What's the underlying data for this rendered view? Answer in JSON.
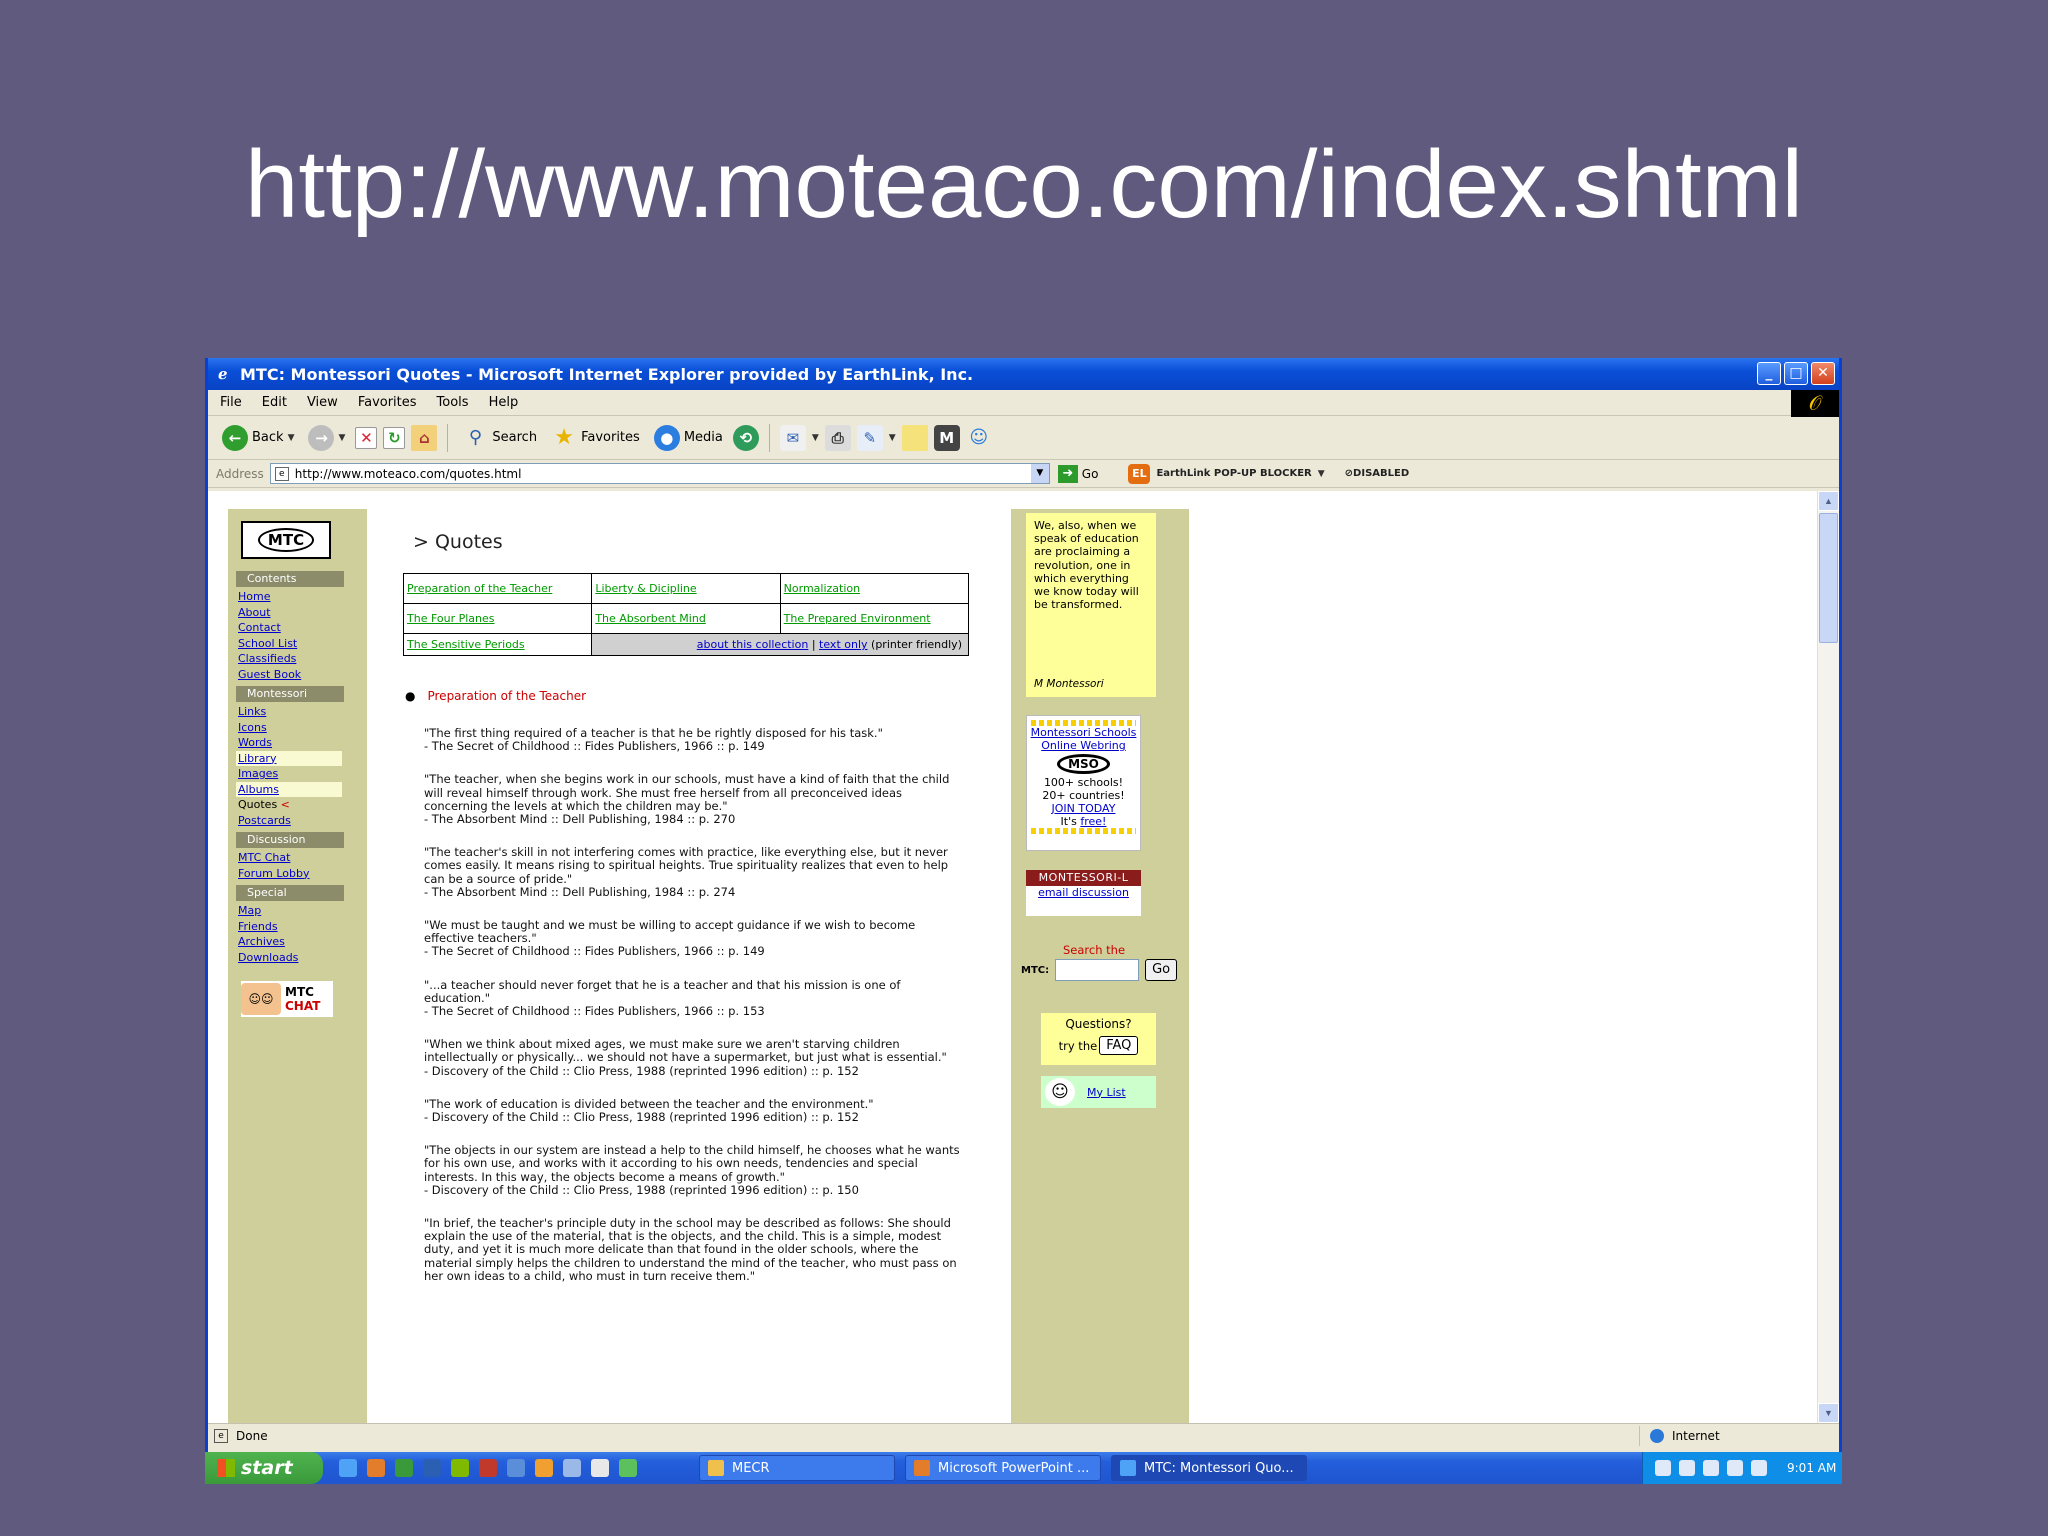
{
  "slide": {
    "title": "http://www.moteaco.com/index.shtml"
  },
  "window": {
    "title": "MTC: Montessori Quotes - Microsoft Internet Explorer provided by EarthLink, Inc.",
    "buttons": {
      "minimize": "_",
      "maximize": "□",
      "close": "✕"
    }
  },
  "menu": [
    "File",
    "Edit",
    "View",
    "Favorites",
    "Tools",
    "Help"
  ],
  "toolbar": {
    "back": "Back",
    "search": "Search",
    "favorites": "Favorites",
    "media": "Media"
  },
  "address": {
    "label": "Address",
    "url": "http://www.moteaco.com/quotes.html",
    "go": "Go",
    "popup_blocker": "EarthLink POP-UP BLOCKER",
    "popup_status": "DISABLED"
  },
  "sidebar": {
    "logo": "MTC",
    "sections": [
      {
        "title": "Contents",
        "links": [
          "Home",
          "About",
          "Contact",
          "School List",
          "Classifieds",
          "Guest Book"
        ]
      },
      {
        "title": "Montessori",
        "links": [
          "Links",
          "Icons",
          "Words",
          "Library",
          "Images",
          "Albums",
          "Quotes",
          "Postcards"
        ]
      },
      {
        "title": "Discussion",
        "links": [
          "MTC Chat",
          "Forum Lobby"
        ]
      },
      {
        "title": "Special",
        "links": [
          "Map",
          "Friends",
          "Archives",
          "Downloads"
        ]
      }
    ],
    "current_marker": "<",
    "chat_badge": {
      "line1": "MTC",
      "line2": "CHAT"
    }
  },
  "content": {
    "breadcrumb": "> Quotes",
    "table": {
      "row1": [
        "Preparation of the Teacher",
        "Liberty & Dicipline",
        "Normalization"
      ],
      "row2": [
        "The Four Planes",
        "The Absorbent Mind",
        "The Prepared Environment"
      ],
      "row3_first": "The Sensitive Periods",
      "about": "about this collection",
      "sep": "|",
      "text_only": "text only",
      "printer": "(printer friendly)"
    },
    "section_title": "Preparation of the Teacher",
    "quotes": [
      {
        "text": "\"The first thing required of a teacher is that he be rightly disposed for his task.\"",
        "source": "- The Secret of Childhood :: Fides Publishers, 1966 :: p. 149"
      },
      {
        "text": "\"The teacher, when she begins work in our schools, must have a kind of faith that the child will reveal himself through work. She must free herself from all preconceived ideas concerning the levels at which the children may be.\"",
        "source": "- The Absorbent Mind :: Dell Publishing, 1984 :: p. 270"
      },
      {
        "text": "\"The teacher's skill in not interfering comes with practice, like everything else, but it never comes easily. It means rising to spiritual heights. True spirituality realizes that even to help can be a source of pride.\"",
        "source": "- The Absorbent Mind :: Dell Publishing, 1984 :: p. 274"
      },
      {
        "text": "\"We must be taught and we must be willing to accept guidance if we wish to become effective teachers.\"",
        "source": "- The Secret of Childhood :: Fides Publishers, 1966 :: p. 149"
      },
      {
        "text": "\"...a teacher should never forget that he is a teacher and that his mission is one of education.\"",
        "source": "- The Secret of Childhood :: Fides Publishers, 1966 :: p. 153"
      },
      {
        "text": "\"When we think about mixed ages, we must make sure we aren't starving children intellectually or physically... we should not have a supermarket, but just what is essential.\"",
        "source": "- Discovery of the Child :: Clio Press, 1988 (reprinted 1996 edition) :: p. 152"
      },
      {
        "text": "\"The work of education is divided between the teacher and the environment.\"",
        "source": "- Discovery of the Child :: Clio Press, 1988 (reprinted 1996 edition) :: p. 152"
      },
      {
        "text": "\"The objects in our system are instead a help to the child himself, he chooses what he wants for his own use, and works with it according to his own needs, tendencies and special interests. In this way, the objects become a means of growth.\"",
        "source": "- Discovery of the Child :: Clio Press, 1988 (reprinted 1996 edition) :: p. 150"
      },
      {
        "text": "\"In brief, the teacher's principle duty in the school may be described as follows: She should explain the use of the material, that is the objects, and the child. This is a simple, modest duty, and yet it is much more delicate than that found in the older schools, where the material simply helps the children to understand the mind of the teacher, who must pass on her own ideas to a child, who must in turn receive them.\"",
        "source": ""
      }
    ]
  },
  "right": {
    "featured_quote": "We, also, when we speak of education are proclaiming a revolution, one in which everything we know today will be transformed.",
    "featured_attr": "M Montessori",
    "mso": {
      "title": "Montessori Schools Online Webring",
      "logo": "MSO",
      "stat1": "100+ schools!",
      "stat2": "20+ countries!",
      "join": "JOIN TODAY",
      "free_prefix": "It's",
      "free": "free!"
    },
    "mlist": {
      "head": "MONTESSORI-L",
      "link": "email discussion"
    },
    "search": {
      "label": "Search the",
      "prefix": "MTC:",
      "go": "Go"
    },
    "faq": {
      "question": "Questions?",
      "try": "try the",
      "button": "FAQ"
    },
    "mylist": "My List"
  },
  "status": {
    "text": "Done",
    "zone": "Internet"
  },
  "taskbar": {
    "start": "start",
    "tasks": [
      "MECR",
      "Microsoft PowerPoint ...",
      "MTC: Montessori Quo..."
    ],
    "clock": "9:01 AM"
  }
}
